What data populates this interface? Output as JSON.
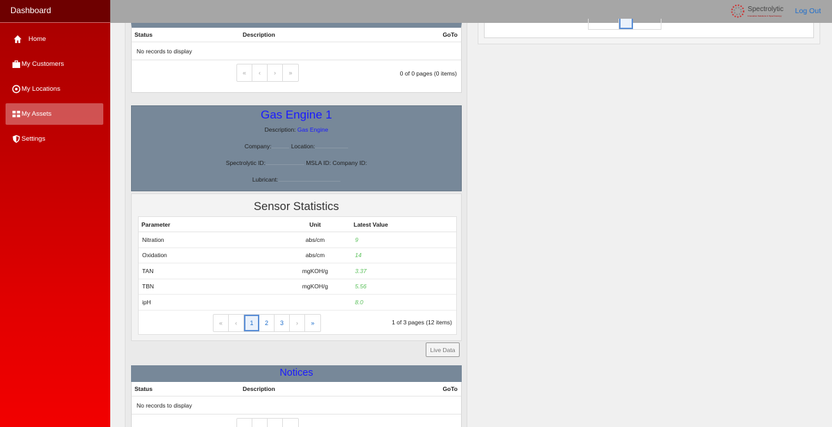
{
  "sidebar": {
    "title": "Dashboard",
    "items": [
      {
        "label": "Home",
        "icon": "home-icon"
      },
      {
        "label": "My Customers",
        "icon": "briefcase-icon"
      },
      {
        "label": "My Locations",
        "icon": "target-icon"
      },
      {
        "label": "My Assets",
        "icon": "assets-icon",
        "active": true
      },
      {
        "label": "Settings",
        "icon": "shield-icon"
      }
    ]
  },
  "topbar": {
    "logo_text": "Spectrolytic",
    "logo_sub": "Innovative Solutions in Spectroscopy",
    "logout_label": "Log Out"
  },
  "alerts_table": {
    "columns": [
      "Status",
      "Description",
      "GoTo"
    ],
    "empty_text": "No records to display",
    "pager_summary": "0 of 0 pages (0 items)",
    "pager_buttons": [
      "«",
      "‹",
      "›",
      "»"
    ]
  },
  "asset": {
    "title": "Gas Engine 1",
    "description_label": "Description:",
    "description_value": "Gas Engine",
    "company_label": "Company:",
    "location_label": "Location:",
    "spectrolytic_id_label": "Spectrolytic ID:",
    "msla_id_label": "MSLA ID:",
    "company_id_label": "Company ID:",
    "lubricant_label": "Lubricant:"
  },
  "sensor_stats": {
    "title": "Sensor Statistics",
    "columns": [
      "Parameter",
      "Unit",
      "Latest Value"
    ],
    "rows": [
      {
        "parameter": "Nitration",
        "unit": "abs/cm",
        "value": "9"
      },
      {
        "parameter": "Oxidation",
        "unit": "abs/cm",
        "value": "14"
      },
      {
        "parameter": "TAN",
        "unit": "mgKOH/g",
        "value": "3.37"
      },
      {
        "parameter": "TBN",
        "unit": "mgKOH/g",
        "value": "5.56"
      },
      {
        "parameter": "ipH",
        "unit": "",
        "value": "8.0"
      }
    ],
    "pager": {
      "first": "«",
      "prev": "‹",
      "pages": [
        "1",
        "2",
        "3"
      ],
      "active_page": "1",
      "next": "›",
      "last": "»"
    },
    "pager_summary": "1 of 3 pages (12 items)",
    "live_data_label": "Live Data"
  },
  "notices": {
    "title": "Notices",
    "columns": [
      "Status",
      "Description",
      "GoTo"
    ],
    "empty_text": "No records to display"
  },
  "colors": {
    "sidebar_red": "#e00000",
    "banner_gray": "#778899",
    "title_blue": "#1a1aff",
    "value_green": "#5cc15c",
    "link_blue": "#1f6fcc"
  }
}
